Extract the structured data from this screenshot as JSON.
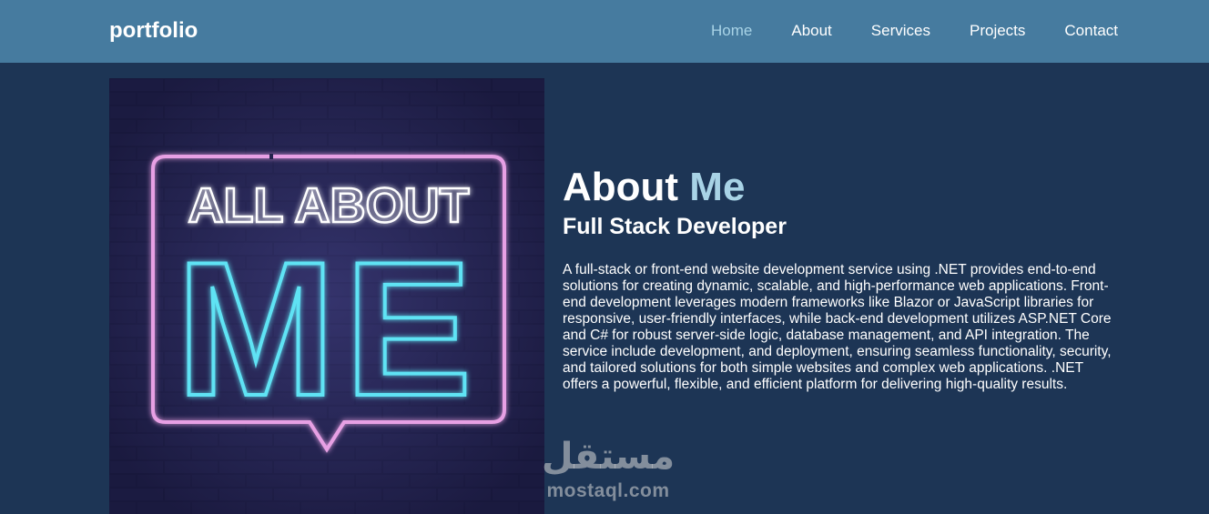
{
  "header": {
    "logo": "portfolio",
    "nav": [
      {
        "label": "Home",
        "active": true
      },
      {
        "label": "About",
        "active": false
      },
      {
        "label": "Services",
        "active": false
      },
      {
        "label": "Projects",
        "active": false
      },
      {
        "label": "Contact",
        "active": false
      }
    ]
  },
  "hero_image": {
    "line1": "ALL ABOUT",
    "line2": "ME"
  },
  "about": {
    "title_main": "About",
    "title_accent": "Me",
    "subtitle": "Full Stack Developer",
    "description": "A full-stack or front-end website development service using .NET provides end-to-end solutions for creating dynamic, scalable, and high-performance web applications. Front-end development leverages modern frameworks like Blazor or JavaScript libraries for responsive, user-friendly interfaces, while back-end development utilizes ASP.NET Core and C# for robust server-side logic, database management, and API integration. The service include development, and deployment, ensuring seamless functionality, security, and tailored solutions for both simple websites and complex web applications. .NET offers a powerful, flexible, and efficient platform for delivering high-quality results."
  },
  "watermark": {
    "arabic": "مستقل",
    "latin": "mostaql.com"
  },
  "colors": {
    "navbar": "#467b9f",
    "background": "#1d3555",
    "accent": "#a8d3e6",
    "neon_pink": "#e7a0e4",
    "neon_cyan": "#5fe3f4"
  }
}
